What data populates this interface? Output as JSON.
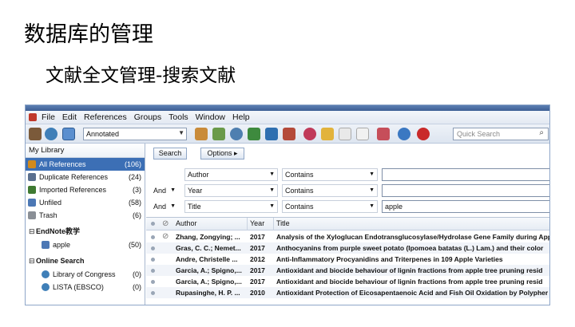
{
  "slide": {
    "title": "数据库的管理",
    "subtitle": "文献全文管理-搜索文献"
  },
  "app": {
    "menu": [
      "File",
      "Edit",
      "References",
      "Groups",
      "Tools",
      "Window",
      "Help"
    ],
    "toolbar": {
      "style_value": "Annotated",
      "quick_search_placeholder": "Quick Search"
    },
    "sidebar": {
      "header": "My Library",
      "items": [
        {
          "label": "All References",
          "count": "(106)",
          "icon": "all-references-icon",
          "color": "#d08a1e"
        },
        {
          "label": "Duplicate References",
          "count": "(24)",
          "icon": "duplicate-references-icon",
          "color": "#5a6f8e"
        },
        {
          "label": "Imported References",
          "count": "(3)",
          "icon": "imported-references-icon",
          "color": "#3f7a32"
        },
        {
          "label": "Unfiled",
          "count": "(58)",
          "icon": "unfiled-icon",
          "color": "#4c78b5"
        },
        {
          "label": "Trash",
          "count": "(6)",
          "icon": "trash-icon",
          "color": "#8a8f96"
        }
      ],
      "groups": [
        {
          "label": "EndNote教学",
          "children": [
            {
              "label": "apple",
              "count": "(50)",
              "icon": "folder-icon",
              "color": "#4c78b5"
            }
          ]
        },
        {
          "label": "Online Search",
          "children": [
            {
              "label": "Library of Congress",
              "count": "(0)",
              "icon": "online-search-icon",
              "color": "#3f7fb8"
            },
            {
              "label": "LISTA (EBSCO)",
              "count": "(0)",
              "icon": "online-search-icon",
              "color": "#3f7fb8"
            }
          ]
        }
      ]
    },
    "search": {
      "search_label": "Search",
      "options_label": "Options ▸",
      "rows": [
        {
          "bool": "",
          "field": "Author",
          "operator": "Contains",
          "value": ""
        },
        {
          "bool": "And",
          "field": "Year",
          "operator": "Contains",
          "value": ""
        },
        {
          "bool": "And",
          "field": "Title",
          "operator": "Contains",
          "value": "apple"
        }
      ]
    },
    "results": {
      "columns": [
        "Author",
        "Year",
        "Title"
      ],
      "rows": [
        {
          "author": "Zhang, Zongying; ...",
          "year": "2017",
          "title": "Analysis of the Xyloglucan Endotransglucosylase/Hydrolase Gene Family during App",
          "attachment": true
        },
        {
          "author": "Gras, C. C.; Nemet...",
          "year": "2017",
          "title": "Anthocyanins from purple sweet potato (Ipomoea batatas (L.) Lam.) and their color",
          "attachment": false
        },
        {
          "author": "Andre, Christelle ...",
          "year": "2012",
          "title": "Anti-Inflammatory Procyanidins and Triterpenes in 109 Apple Varieties",
          "attachment": false
        },
        {
          "author": "Garcia, A.; Spigno,...",
          "year": "2017",
          "title": "Antioxidant and biocide behaviour of lignin fractions from apple tree pruning resid",
          "attachment": false
        },
        {
          "author": "Garcia, A.; Spigno,...",
          "year": "2017",
          "title": "Antioxidant and biocide behaviour of lignin fractions from apple tree pruning resid",
          "attachment": false
        },
        {
          "author": "Rupasinghe, H. P. ...",
          "year": "2010",
          "title": "Antioxidant Protection of Eicosapentaenoic Acid and Fish Oil Oxidation by Polypher",
          "attachment": false
        }
      ]
    }
  }
}
